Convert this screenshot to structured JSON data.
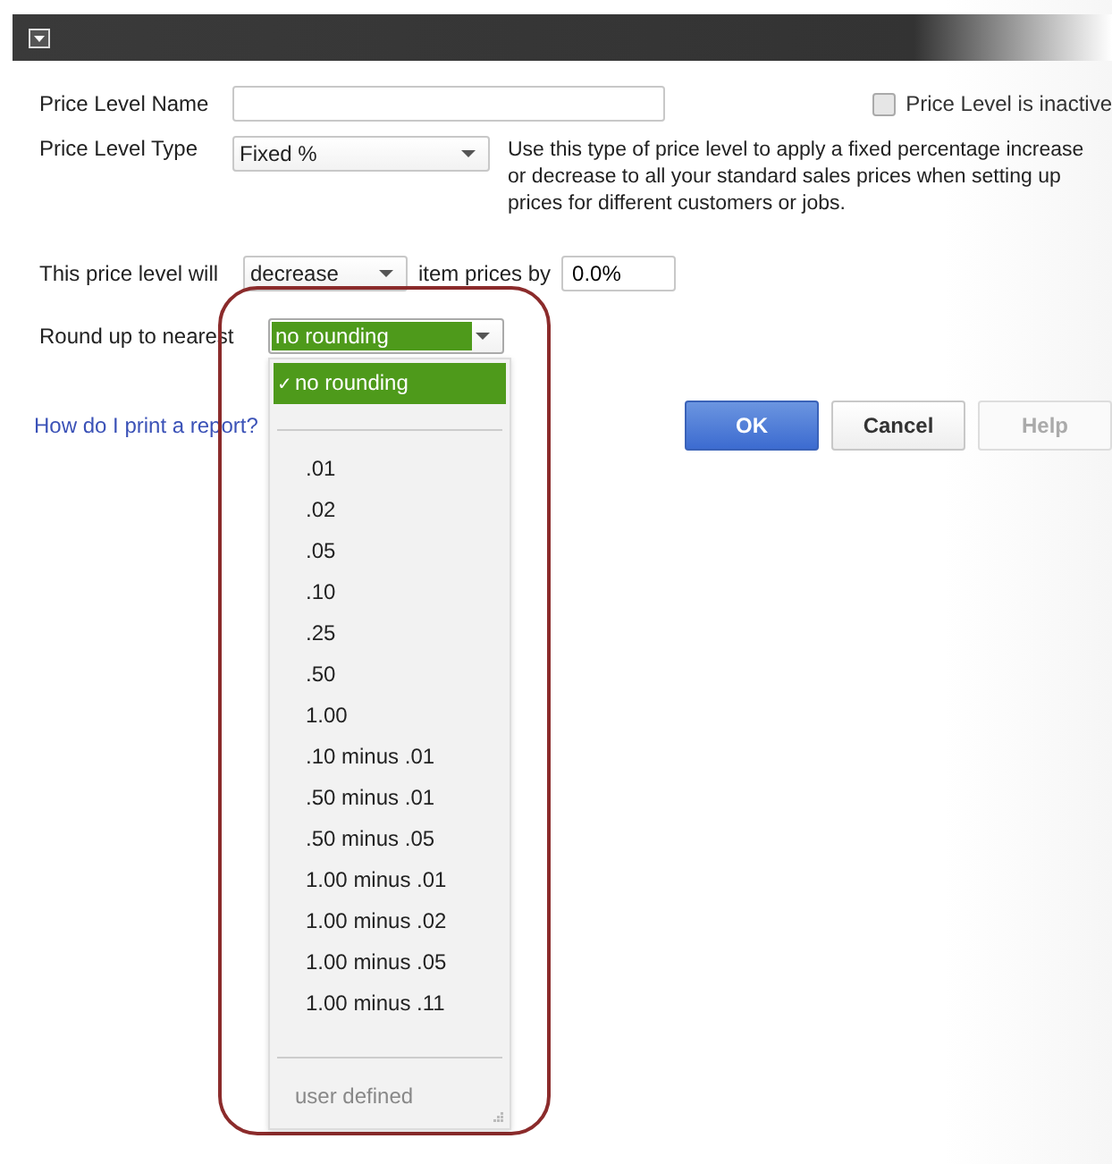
{
  "name_field": {
    "label": "Price Level Name"
  },
  "inactive_checkbox": {
    "label": "Price Level is inactive",
    "checked": false
  },
  "type_field": {
    "label": "Price Level Type",
    "value": "Fixed %"
  },
  "description": "Use this type of price level to apply a fixed percentage increase or decrease to all your standard sales prices when setting up prices for different customers or jobs.",
  "adjust": {
    "label": "This price level will",
    "direction": "decrease",
    "middle_label": "item prices by",
    "percent": "0.0%"
  },
  "rounding": {
    "label": "Round up to nearest",
    "value": "no rounding",
    "expanded": true,
    "check_mark": "✓",
    "sections": [
      {
        "items": [
          {
            "label": "no rounding",
            "selected": true,
            "disabled": false
          }
        ]
      },
      {
        "items": [
          {
            "label": ".01",
            "selected": false,
            "disabled": false
          },
          {
            "label": ".02",
            "selected": false,
            "disabled": false
          },
          {
            "label": ".05",
            "selected": false,
            "disabled": false
          },
          {
            "label": ".10",
            "selected": false,
            "disabled": false
          },
          {
            "label": ".25",
            "selected": false,
            "disabled": false
          },
          {
            "label": ".50",
            "selected": false,
            "disabled": false
          },
          {
            "label": "1.00",
            "selected": false,
            "disabled": false
          },
          {
            "label": ".10 minus .01",
            "selected": false,
            "disabled": false
          },
          {
            "label": ".50 minus .01",
            "selected": false,
            "disabled": false
          },
          {
            "label": ".50 minus .05",
            "selected": false,
            "disabled": false
          },
          {
            "label": "1.00 minus .01",
            "selected": false,
            "disabled": false
          },
          {
            "label": "1.00 minus .02",
            "selected": false,
            "disabled": false
          },
          {
            "label": "1.00 minus .05",
            "selected": false,
            "disabled": false
          },
          {
            "label": "1.00 minus .11",
            "selected": false,
            "disabled": false
          }
        ]
      },
      {
        "items": [
          {
            "label": "user defined",
            "selected": false,
            "disabled": true
          }
        ]
      }
    ]
  },
  "help_link": "How do I print a report?",
  "buttons": [
    {
      "label": "OK",
      "kind": "primary",
      "disabled": false
    },
    {
      "label": "Cancel",
      "kind": "normal",
      "disabled": false
    },
    {
      "label": "Help",
      "kind": "normal",
      "disabled": true
    }
  ]
}
